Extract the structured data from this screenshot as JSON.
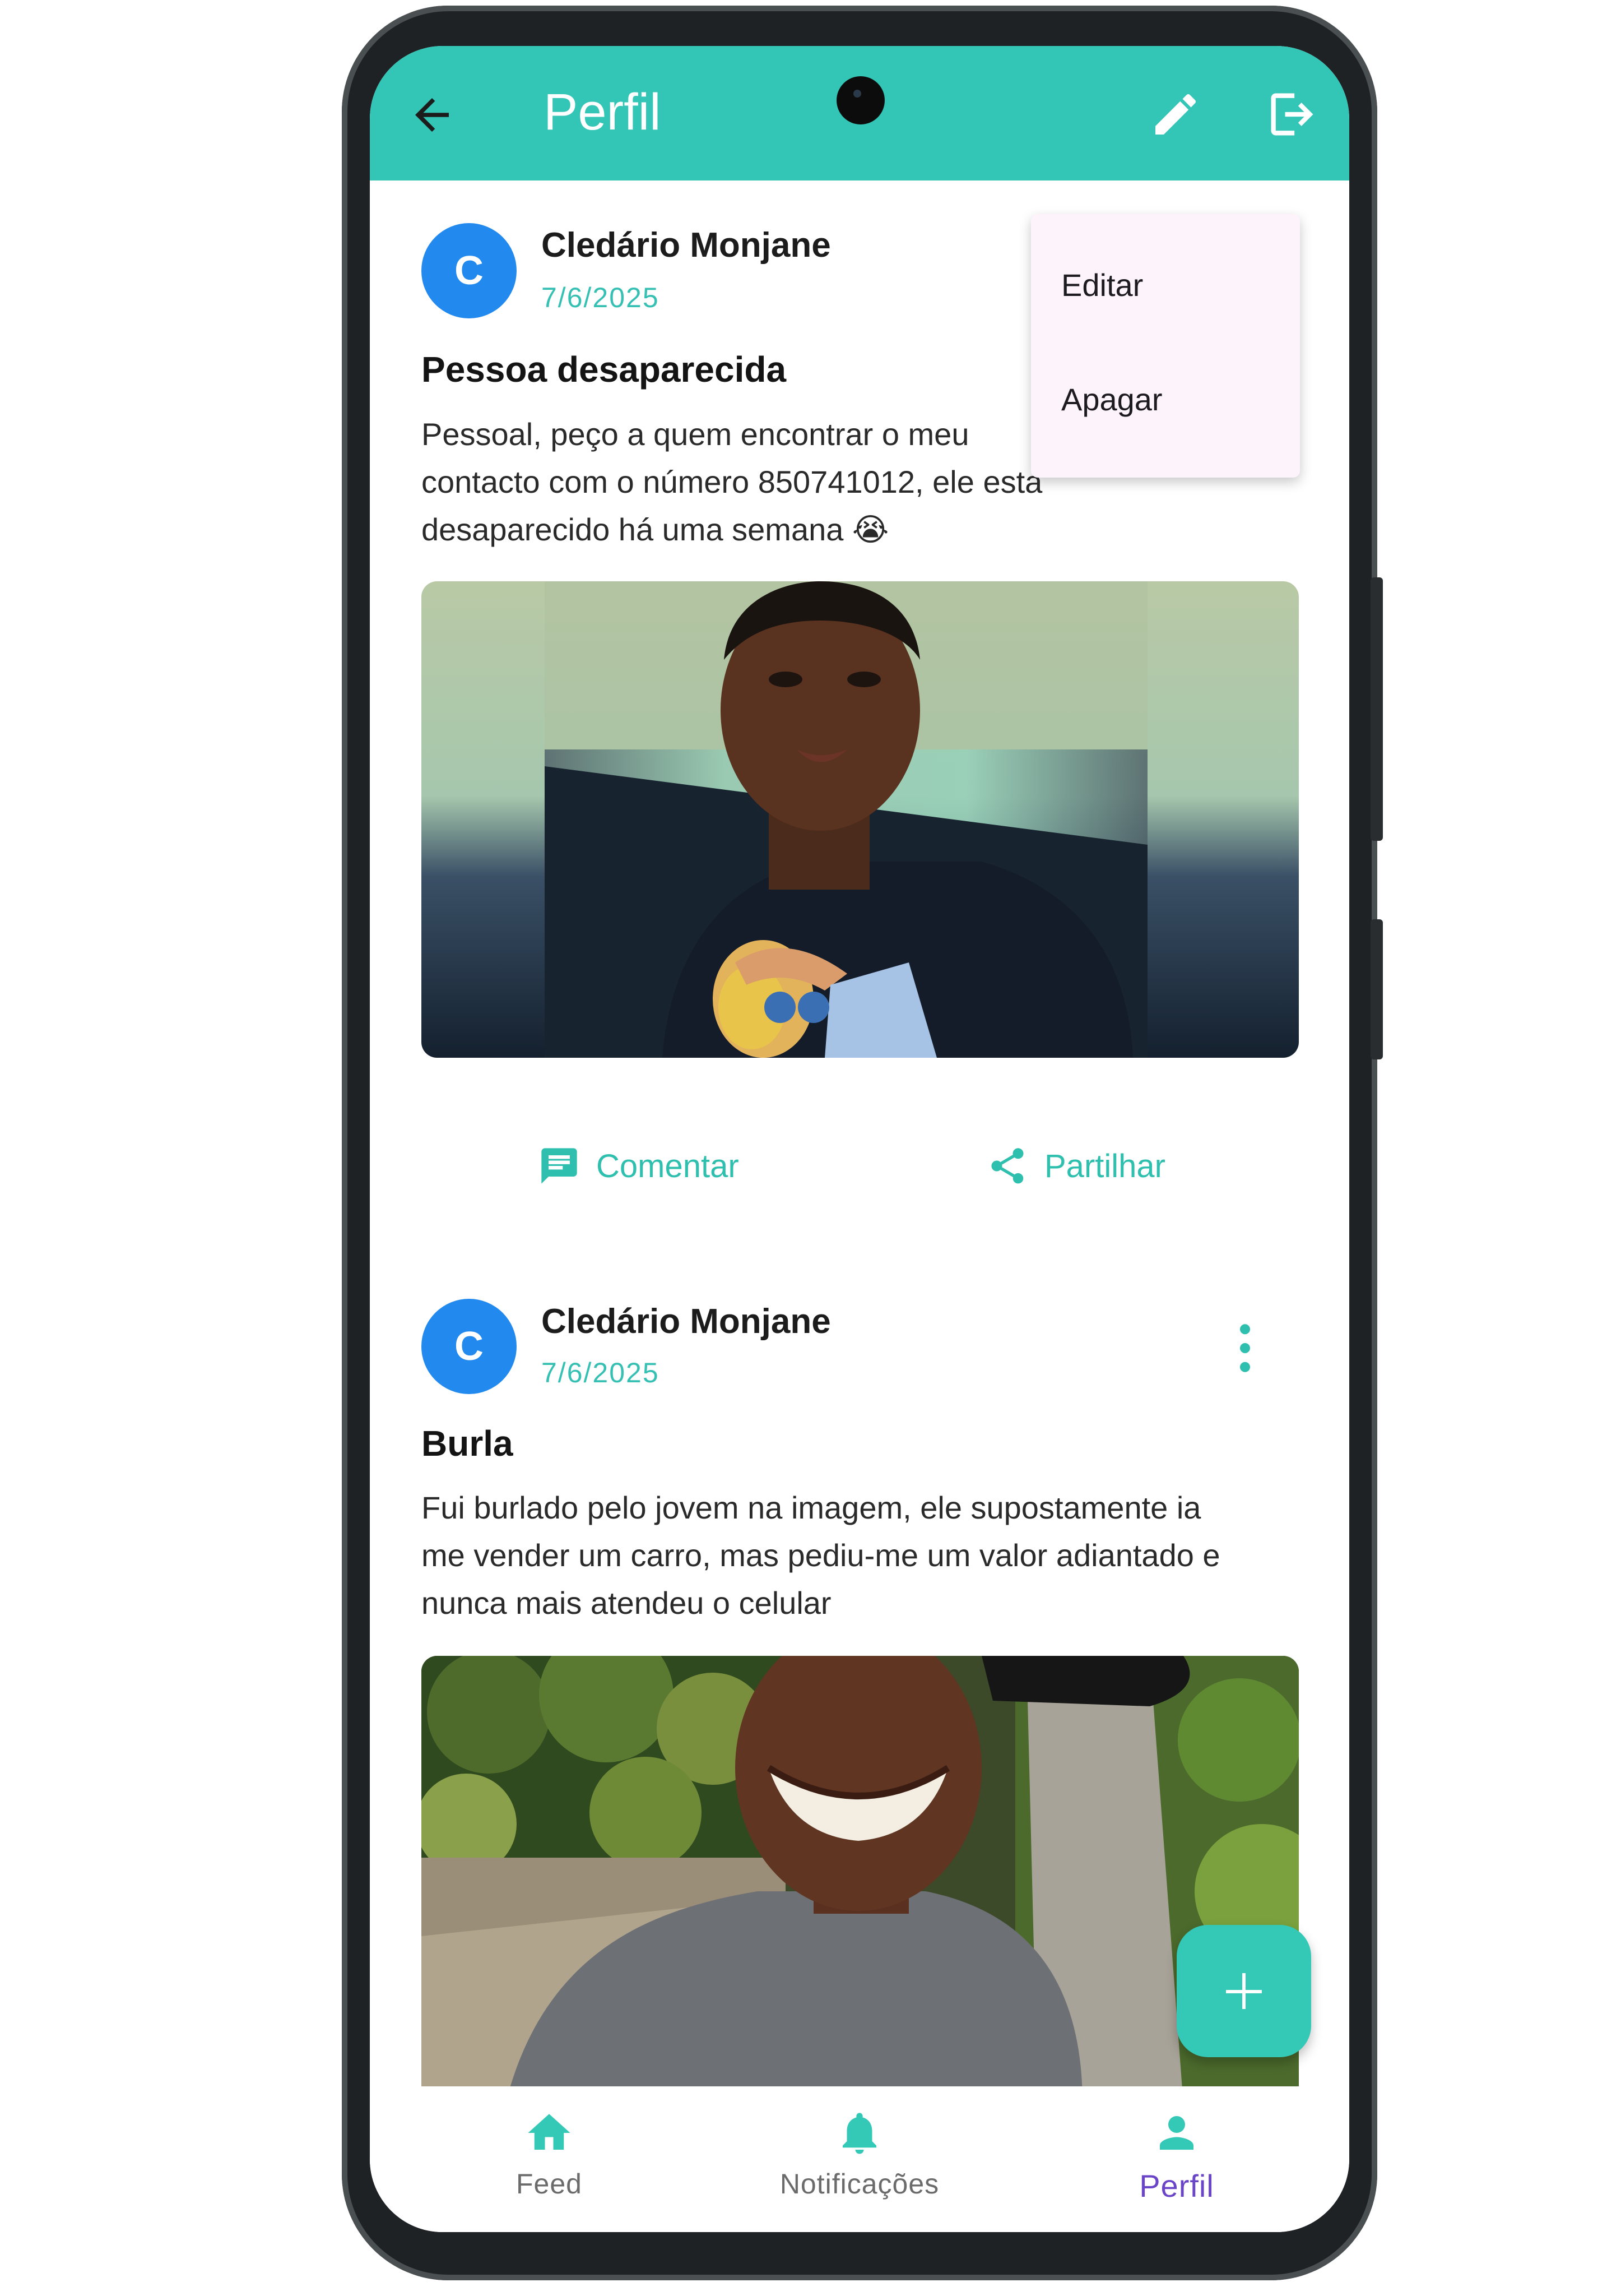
{
  "appbar": {
    "title": "Perfil",
    "back_icon": "arrow-back-icon",
    "edit_icon": "pencil-icon",
    "logout_icon": "logout-icon",
    "color": "#33c6b6"
  },
  "popup_menu": {
    "items": [
      "Editar",
      "Apagar"
    ]
  },
  "posts": [
    {
      "avatar_letter": "C",
      "author": "Cledário Monjane",
      "date": "7/6/2025",
      "title": "Pessoa desaparecida",
      "body_lines": [
        "Pessoal, peço a quem encontrar o meu",
        "contacto com o número 850741012, ele esta",
        "desaparecido há uma semana 😭"
      ],
      "image": "photo-young-man-selfie",
      "actions": {
        "comment": "Comentar",
        "share": "Partilhar"
      }
    },
    {
      "avatar_letter": "C",
      "author": "Cledário Monjane",
      "date": "7/6/2025",
      "title": "Burla",
      "body_lines": [
        "Fui burlado pelo jovem na imagem, ele supostamente ia",
        "me vender um carro, mas pediu-me um valor adiantado e",
        "nunca mais atendeu o celular"
      ],
      "image": "photo-smiling-young-man-outdoors"
    }
  ],
  "fab": {
    "icon": "plus-icon"
  },
  "bottom_nav": {
    "items": [
      {
        "label": "Feed",
        "icon": "home-icon"
      },
      {
        "label": "Notificações",
        "icon": "bell-icon"
      },
      {
        "label": "Perfil",
        "icon": "person-icon",
        "active": true
      }
    ],
    "active_color": "#6a45c8",
    "accent": "#34c9b6"
  }
}
